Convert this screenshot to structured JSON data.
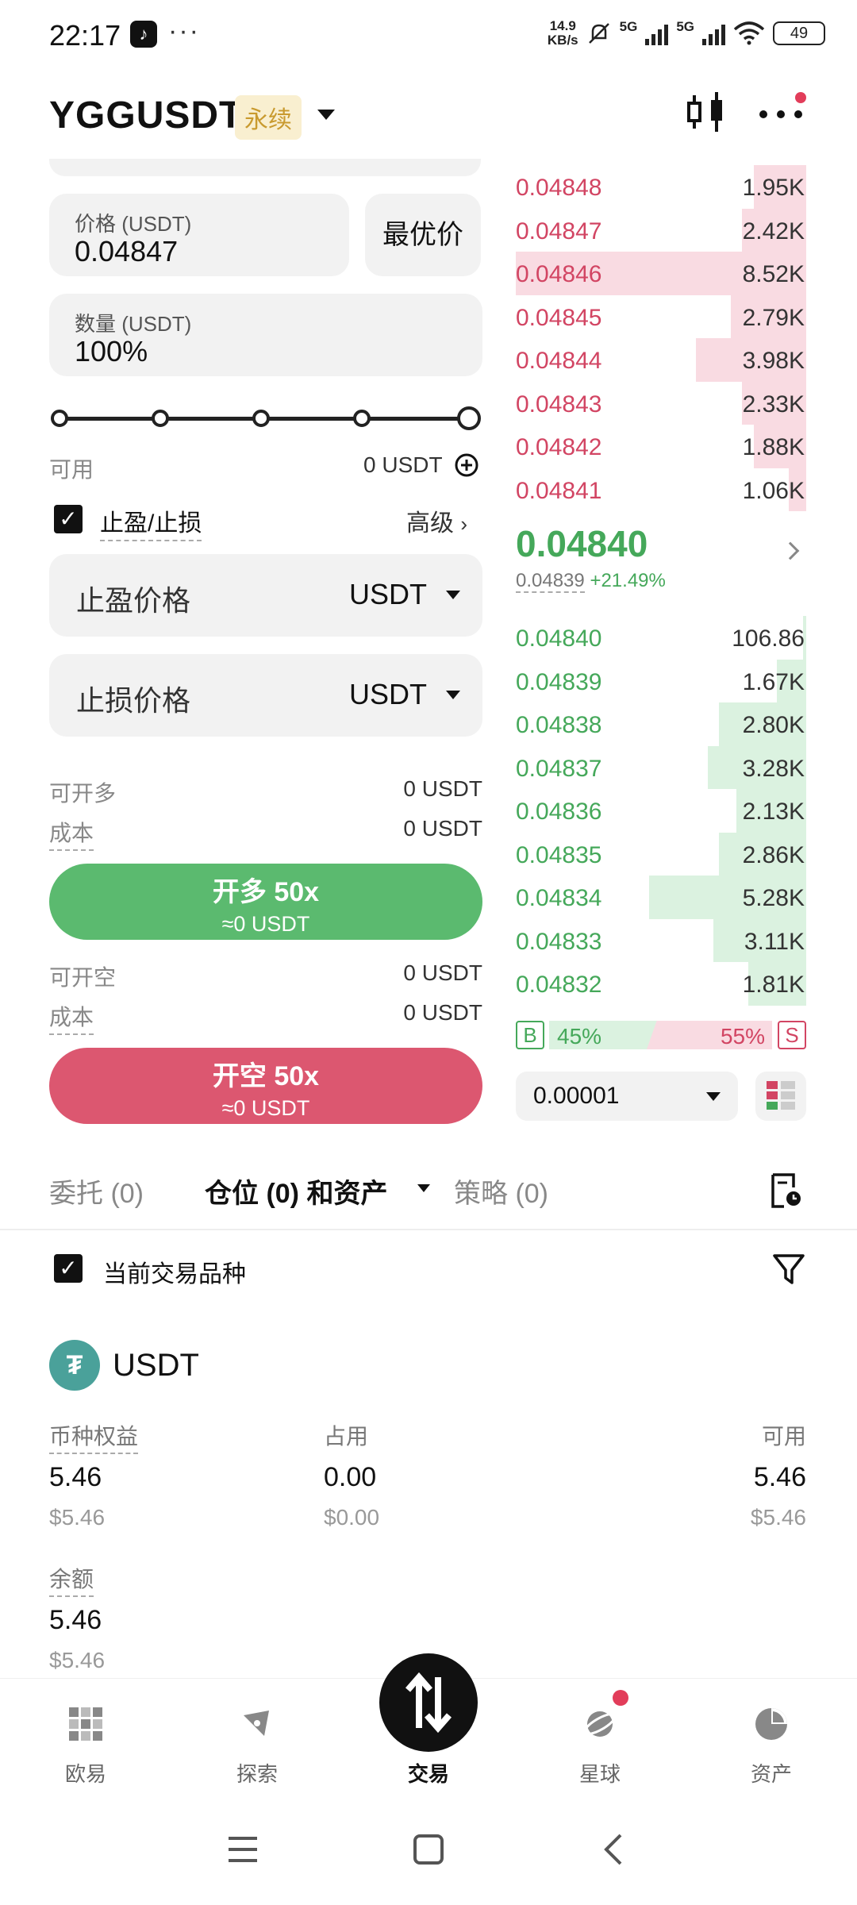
{
  "status": {
    "time": "22:17",
    "app_glyph": "♪",
    "more": "···",
    "net_speed_top": "14.9",
    "net_speed_bottom": "KB/s",
    "sig1": "5G",
    "sig2": "5G",
    "battery": "49"
  },
  "header": {
    "symbol": "YGGUSDT",
    "badge": "永续"
  },
  "form": {
    "price_label": "价格 (USDT)",
    "price_value": "0.04847",
    "best_price": "最优价",
    "qty_label": "数量 (USDT)",
    "qty_value": "100%",
    "available_label": "可用",
    "available_value": "0 USDT",
    "tpsl_label": "止盈/止损",
    "advanced": "高级",
    "tp_placeholder": "止盈价格",
    "tp_unit": "USDT",
    "sl_placeholder": "止损价格",
    "sl_unit": "USDT",
    "can_long_label": "可开多",
    "can_long_value": "0 USDT",
    "cost_label": "成本",
    "cost_long_value": "0 USDT",
    "long_btn": "开多 50x",
    "long_sub": "≈0 USDT",
    "can_short_label": "可开空",
    "can_short_value": "0 USDT",
    "cost_short_label": "成本",
    "cost_short_value": "0 USDT",
    "short_btn": "开空 50x",
    "short_sub": "≈0 USDT"
  },
  "orderbook": {
    "asks": [
      {
        "price": "0.04848",
        "qty": "1.95K",
        "depth": 0.18
      },
      {
        "price": "0.04847",
        "qty": "2.42K",
        "depth": 0.22
      },
      {
        "price": "0.04846",
        "qty": "8.52K",
        "depth": 1.0
      },
      {
        "price": "0.04845",
        "qty": "2.79K",
        "depth": 0.26
      },
      {
        "price": "0.04844",
        "qty": "3.98K",
        "depth": 0.38
      },
      {
        "price": "0.04843",
        "qty": "2.33K",
        "depth": 0.22
      },
      {
        "price": "0.04842",
        "qty": "1.88K",
        "depth": 0.18
      },
      {
        "price": "0.04841",
        "qty": "1.06K",
        "depth": 0.06
      }
    ],
    "mid_price": "0.04840",
    "mark_price": "0.04839",
    "change": "+21.49%",
    "bids": [
      {
        "price": "0.04840",
        "qty": "106.86",
        "depth": 0.01
      },
      {
        "price": "0.04839",
        "qty": "1.67K",
        "depth": 0.1
      },
      {
        "price": "0.04838",
        "qty": "2.80K",
        "depth": 0.3
      },
      {
        "price": "0.04837",
        "qty": "3.28K",
        "depth": 0.34
      },
      {
        "price": "0.04836",
        "qty": "2.13K",
        "depth": 0.24
      },
      {
        "price": "0.04835",
        "qty": "2.86K",
        "depth": 0.3
      },
      {
        "price": "0.04834",
        "qty": "5.28K",
        "depth": 0.54
      },
      {
        "price": "0.04833",
        "qty": "3.11K",
        "depth": 0.32
      },
      {
        "price": "0.04832",
        "qty": "1.81K",
        "depth": 0.2
      }
    ],
    "buy_tag": "B",
    "buy_pct": "45%",
    "sell_pct": "55%",
    "sell_tag": "S",
    "precision": "0.00001"
  },
  "tabs": {
    "orders": "委托 (0)",
    "positions": "仓位 (0) 和资产",
    "strategy": "策略 (0)"
  },
  "filter": {
    "current_symbol": "当前交易品种"
  },
  "asset": {
    "coin_glyph": "₮",
    "coin": "USDT",
    "equity_label": "币种权益",
    "equity_value": "5.46",
    "equity_usd": "$5.46",
    "used_label": "占用",
    "used_value": "0.00",
    "used_usd": "$0.00",
    "avail_label": "可用",
    "avail_value": "5.46",
    "avail_usd": "$5.46",
    "balance_label": "余额",
    "balance_value": "5.46",
    "balance_usd": "$5.46"
  },
  "nav": {
    "home": "欧易",
    "explore": "探索",
    "trade": "交易",
    "planet": "星球",
    "assets": "资产"
  },
  "colors": {
    "green": "#45a85a",
    "red": "#d24563",
    "long_btn": "#5bba6f",
    "short_btn": "#dc5770",
    "badge_bg": "#f9efd0",
    "badge_text": "#c99a2e"
  }
}
